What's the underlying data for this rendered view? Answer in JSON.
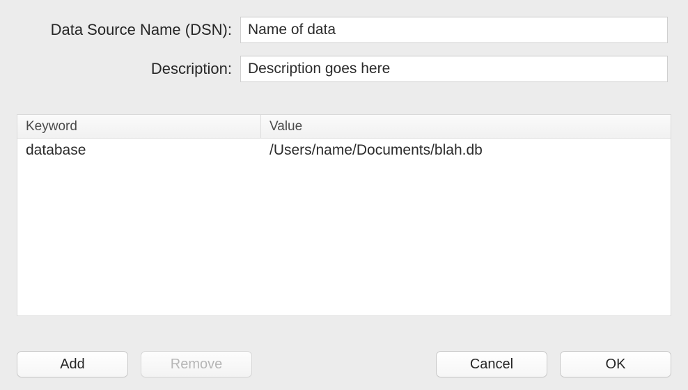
{
  "form": {
    "dsn_label": "Data Source Name (DSN):",
    "dsn_value": "Name of data",
    "desc_label": "Description:",
    "desc_value": "Description goes here"
  },
  "table": {
    "headers": {
      "keyword": "Keyword",
      "value": "Value"
    },
    "rows": [
      {
        "keyword": "database",
        "value": "/Users/name/Documents/blah.db"
      }
    ]
  },
  "buttons": {
    "add": "Add",
    "remove": "Remove",
    "cancel": "Cancel",
    "ok": "OK"
  }
}
